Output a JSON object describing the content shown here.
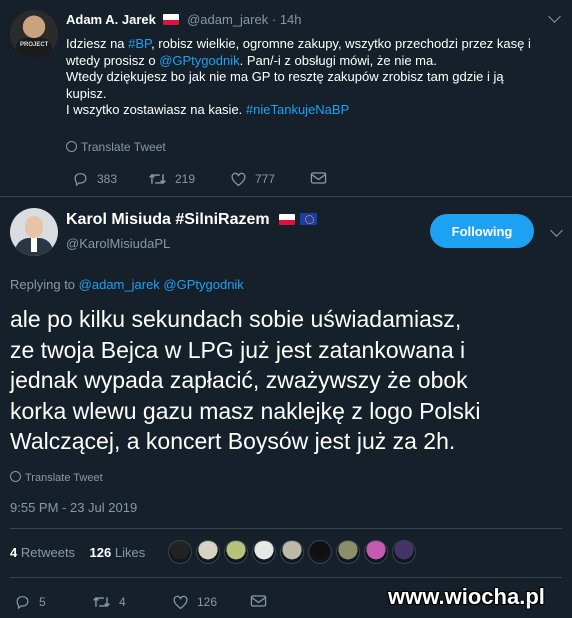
{
  "parent_tweet": {
    "author_name": "Adam A. Jarek",
    "handle": "@adam_jarek",
    "dot": "·",
    "time": "14h",
    "lines": [
      [
        {
          "t": "Idziesz na "
        },
        {
          "t": "#BP",
          "link": true
        },
        {
          "t": ", robisz wielkie, ogromne zakupy, wszytko  przechodzi przez kasę  i"
        }
      ],
      [
        {
          "t": "wtedy prosisz o "
        },
        {
          "t": "@GPtygodnik",
          "link": true
        },
        {
          "t": ". Pan/-i z obsługi mówi, że nie ma."
        }
      ],
      [
        {
          "t": "Wtedy dziękujesz bo jak nie ma GP to resztę zakupów zrobisz tam gdzie i ją"
        }
      ],
      [
        {
          "t": "kupisz."
        }
      ],
      [
        {
          "t": "I wszytko zostawiasz na kasie. "
        },
        {
          "t": "#nieTankujeNaBP",
          "link": true
        }
      ]
    ],
    "translate_label": "Translate Tweet",
    "replies": "383",
    "retweets": "219",
    "likes": "777"
  },
  "main_tweet": {
    "author_name": "Karol Misiuda #SilniRazem",
    "handle": "@KarolMisiudaPL",
    "follow_label": "Following",
    "replying_prefix": "Replying to",
    "replying_handles": "@adam_jarek @GPtygodnik",
    "text_lines": [
      "ale po kilku sekundach sobie uświadamiasz,",
      "ze twoja Bejca w LPG już jest zatankowana i",
      "jednak wypada zapłacić, zważywszy że obok",
      "korka wlewu gazu masz naklejkę z logo Polski",
      "Walczącej, a koncert Boysów jest już za 2h."
    ],
    "translate_label": "Translate Tweet",
    "timestamp": "9:55 PM - 23 Jul 2019",
    "retweets_count": "4",
    "retweets_label": "Retweets",
    "likes_count": "126",
    "likes_label": "Likes",
    "liker_avatar_colors": [
      "#222222",
      "#d8d2c4",
      "#b7c27a",
      "#e8e8e8",
      "#bdb9a6",
      "#111111",
      "#8a8f6a",
      "#c55bb0",
      "#443366"
    ],
    "action_replies": "5",
    "action_retweets": "4",
    "action_likes": "126"
  },
  "watermark": "www.wiocha.pl",
  "colors": {
    "background": "#15202b",
    "accent": "#1da1f2",
    "muted": "#8899a6",
    "divider": "#38444d"
  }
}
